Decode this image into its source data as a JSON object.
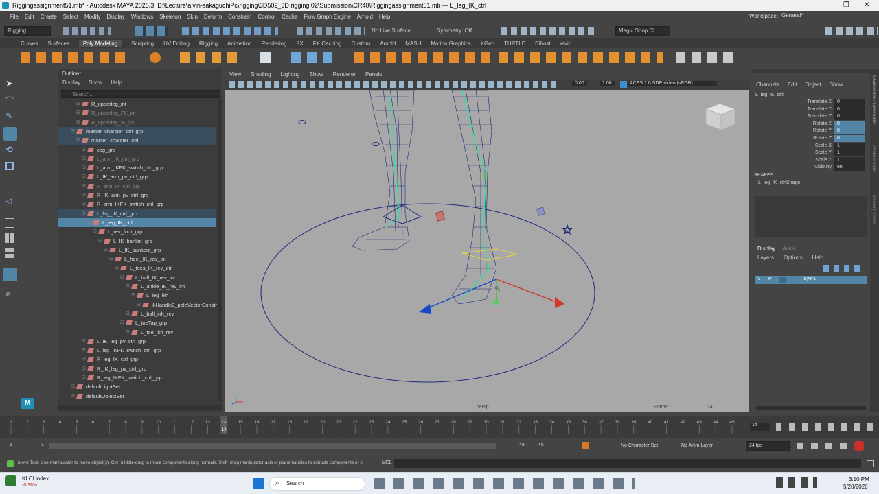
{
  "window": {
    "title": "Riggingassignment51.mb* - Autodesk MAYA 2025.3: D:\\Lecture\\alvin-sakaguchiPc\\rigging\\3D502_3D rigging 02\\Submission\\CR40\\Riggingassignment51.mb  ---  L_leg_IK_ctrl",
    "minimize": "—",
    "maximize": "❐",
    "close": "✕"
  },
  "menu": [
    "File",
    "Edit",
    "Create",
    "Select",
    "Modify",
    "Display",
    "Windows",
    "Skeleton",
    "Skin",
    "Deform",
    "Constrain",
    "Control",
    "Cache",
    "Flow Graph Engine",
    "Arnold",
    "Help"
  ],
  "workspace": {
    "label": "Workspace:",
    "value": "General*"
  },
  "statusline": {
    "menuset": "Rigging",
    "live_surface": "No Live Surface",
    "symmetry": "Symmetry: Off",
    "magic_shop": "Magic Shop Cl..."
  },
  "shelf_tabs": [
    "Curves",
    "Surfaces",
    "Poly Modeling",
    "Sculpting",
    "UV Editing",
    "Rigging",
    "Animation",
    "Rendering",
    "FX",
    "FX Caching",
    "Custom",
    "Arnold",
    "MASH",
    "Motion Graphics",
    "XGen",
    "TURTLE",
    "Bifrost",
    "alvin"
  ],
  "shelf_active": "Poly Modeling",
  "outliner": {
    "title": "Outliner",
    "menu": [
      "Display",
      "Show",
      "Help"
    ],
    "search_placeholder": "Search...",
    "rows": [
      {
        "label": "R_upperleg_int",
        "indent": 2,
        "state": ""
      },
      {
        "label": "R_upperleg_FK_int",
        "indent": 2,
        "state": "dim"
      },
      {
        "label": "R_upperleg_IK_int",
        "indent": 2,
        "state": "dim"
      },
      {
        "label": "master_charcter_ctrl_grp",
        "indent": 1,
        "state": "sel2"
      },
      {
        "label": "master_charcter_ctrl",
        "indent": 2,
        "state": "sel2"
      },
      {
        "label": "cog_grp",
        "indent": 3,
        "state": ""
      },
      {
        "label": "L_arm_IK_ctrl_grp",
        "indent": 3,
        "state": "dim"
      },
      {
        "label": "L_arm_IKFK_swtich_ctrl_grp",
        "indent": 3,
        "state": ""
      },
      {
        "label": "L_IK_arm_pv_ctrl_grp",
        "indent": 3,
        "state": ""
      },
      {
        "label": "R_arm_IK_ctrl_grp",
        "indent": 3,
        "state": "dim"
      },
      {
        "label": "R_IK_arm_pv_ctrl_grp",
        "indent": 3,
        "state": ""
      },
      {
        "label": "R_arm_IKFK_swtich_ctrl_grp",
        "indent": 3,
        "state": ""
      },
      {
        "label": "L_leg_IK_ctrl_grp",
        "indent": 3,
        "state": "sel2"
      },
      {
        "label": "L_leg_IK_ctrl",
        "indent": 4,
        "state": "sel"
      },
      {
        "label": "L_rev_foot_grp",
        "indent": 5,
        "state": ""
      },
      {
        "label": "L_IK_bankin_grp",
        "indent": 6,
        "state": ""
      },
      {
        "label": "L_IK_bankout_grp",
        "indent": 7,
        "state": ""
      },
      {
        "label": "L_heel_IK_rev_int",
        "indent": 8,
        "state": ""
      },
      {
        "label": "L_toes_IK_rev_int",
        "indent": 9,
        "state": ""
      },
      {
        "label": "L_ball_IK_rev_int",
        "indent": 10,
        "state": ""
      },
      {
        "label": "L_ankle_IK_rev_int",
        "indent": 11,
        "state": ""
      },
      {
        "label": "L_leg_ikh",
        "indent": 12,
        "state": ""
      },
      {
        "label": "ikHandle2_poleVectorConstr",
        "indent": 13,
        "state": ""
      },
      {
        "label": "L_ball_ikh_rev",
        "indent": 11,
        "state": ""
      },
      {
        "label": "L_toeTap_grp",
        "indent": 10,
        "state": ""
      },
      {
        "label": "L_toe_ikh_rev",
        "indent": 11,
        "state": ""
      },
      {
        "label": "L_IK_leg_pv_ctrl_grp",
        "indent": 3,
        "state": ""
      },
      {
        "label": "L_leg_IKFK_swtich_ctrl_grp",
        "indent": 3,
        "state": ""
      },
      {
        "label": "R_leg_IK_ctrl_grp",
        "indent": 3,
        "state": ""
      },
      {
        "label": "R_IK_leg_pv_ctrl_grp",
        "indent": 3,
        "state": ""
      },
      {
        "label": "R_leg_IKFK_swtich_ctrl_grp",
        "indent": 3,
        "state": ""
      },
      {
        "label": "defaultLightSet",
        "indent": 1,
        "state": ""
      },
      {
        "label": "defaultObjectSet",
        "indent": 1,
        "state": ""
      }
    ]
  },
  "viewport": {
    "menu": [
      "View",
      "Shading",
      "Lighting",
      "Show",
      "Renderer",
      "Panels"
    ],
    "near": "0.00",
    "far": "1.00",
    "colorspace": "ACES 1.0 SDR-video (sRGB)",
    "camera": "persp",
    "frame_label": "Frame:",
    "frame_value": "14"
  },
  "channelbox": {
    "tabs": [
      "Channels",
      "Edit",
      "Object",
      "Show"
    ],
    "object": "L_leg_IK_ctrl",
    "attributes": [
      {
        "name": "Translate X",
        "value": "0",
        "hl": false
      },
      {
        "name": "Translate Y",
        "value": "0",
        "hl": false
      },
      {
        "name": "Translate Z",
        "value": "0",
        "hl": false
      },
      {
        "name": "Rotate X",
        "value": "0",
        "hl": true
      },
      {
        "name": "Rotate Y",
        "value": "0",
        "hl": true
      },
      {
        "name": "Rotate Z",
        "value": "0",
        "hl": true
      },
      {
        "name": "Scale X",
        "value": "1",
        "hl": false
      },
      {
        "name": "Scale Y",
        "value": "1",
        "hl": false
      },
      {
        "name": "Scale Z",
        "value": "1",
        "hl": false
      },
      {
        "name": "Visibility",
        "value": "on",
        "hl": false
      }
    ],
    "shapes_label": "SHAPES",
    "shape": "L_leg_IK_ctrlShape",
    "layer_tabs": [
      "Display",
      "Anim"
    ],
    "layer_menu": [
      "Layers",
      "Options",
      "Help"
    ],
    "layer": {
      "v": "V",
      "p": "P",
      "name": "layer1"
    },
    "side_tabs": [
      "Channel Box / Layer Editor",
      "Attribute Editor",
      "Modeling Toolkit"
    ]
  },
  "timeline": {
    "ticks": [
      "1",
      "2",
      "3",
      "4",
      "5",
      "6",
      "7",
      "8",
      "9",
      "10",
      "11",
      "12",
      "13",
      "14",
      "15",
      "16",
      "17",
      "18",
      "19",
      "20",
      "21",
      "22",
      "23",
      "24",
      "25",
      "26",
      "27",
      "28",
      "29",
      "30",
      "31",
      "32",
      "33",
      "34",
      "35",
      "36",
      "37",
      "38",
      "39",
      "40",
      "41",
      "42",
      "43",
      "44",
      "45"
    ],
    "current_frame": "14",
    "current_field": "14"
  },
  "range": {
    "start": "1",
    "start_inner": "1",
    "end_inner": "45",
    "end": "45",
    "character_set": "No Character Set",
    "anim_layer": "No Anim Layer",
    "fps": "24 fps"
  },
  "helpline": {
    "text": "Move Tool: Use manipulator to move object(s). Ctrl+middle-drag to move components along normals. Shift+drag manipulator axis or plane handles to extrude components or c",
    "mel": "MEL"
  },
  "taskbar": {
    "stock_name": "KLCI index",
    "stock_change": "-0.38%",
    "search": "Search",
    "time": "3:10 PM",
    "date": "5/20/2026"
  },
  "colors": {
    "selection": "#5285a6",
    "viewport": "#a8a8a8",
    "wire": "#1f2a7a",
    "joint": "#33e0a0"
  }
}
